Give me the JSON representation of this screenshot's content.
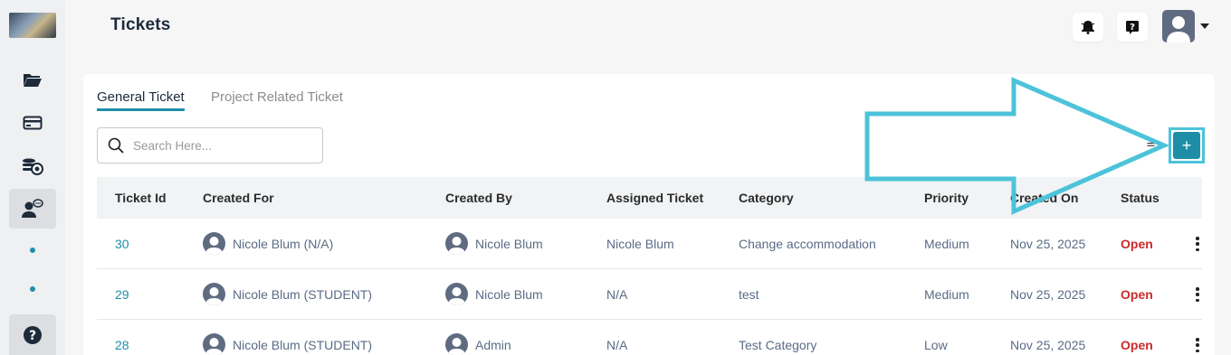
{
  "app": {
    "title": "Tickets"
  },
  "sidebar": {
    "items": [
      {
        "icon": "folder-icon"
      },
      {
        "icon": "card-icon"
      },
      {
        "icon": "coins-icon"
      },
      {
        "icon": "support-user-icon",
        "active": true
      }
    ],
    "help_icon": "help-icon"
  },
  "header": {
    "notification_icon": "bell-icon",
    "help_icon": "question-icon",
    "avatar_icon": "user-avatar-icon"
  },
  "tabs": [
    {
      "label": "General Ticket",
      "active": true
    },
    {
      "label": "Project Related Ticket",
      "active": false
    }
  ],
  "search": {
    "placeholder": "Search Here..."
  },
  "toolbar": {
    "filter_hint": "≟",
    "add_label": "+"
  },
  "table": {
    "columns": [
      "Ticket Id",
      "Created For",
      "Created By",
      "Assigned Ticket",
      "Category",
      "Priority",
      "Created On",
      "Status"
    ],
    "rows": [
      {
        "id": "30",
        "created_for": "Nicole Blum (N/A)",
        "created_by": "Nicole Blum",
        "assigned": "Nicole Blum",
        "category": "Change accommodation",
        "priority": "Medium",
        "created_on": "Nov 25, 2025",
        "status": "Open"
      },
      {
        "id": "29",
        "created_for": "Nicole Blum (STUDENT)",
        "created_by": "Nicole Blum",
        "assigned": "N/A",
        "category": "test",
        "priority": "Medium",
        "created_on": "Nov 25, 2025",
        "status": "Open"
      },
      {
        "id": "28",
        "created_for": "Nicole Blum (STUDENT)",
        "created_by": "Admin",
        "assigned": "N/A",
        "category": "Test Category",
        "priority": "Low",
        "created_on": "Nov 25, 2025",
        "status": "Open"
      }
    ]
  },
  "colors": {
    "accent": "#1e8ea6",
    "status_open": "#cc2a2a",
    "arrow": "#4cc3d9"
  }
}
